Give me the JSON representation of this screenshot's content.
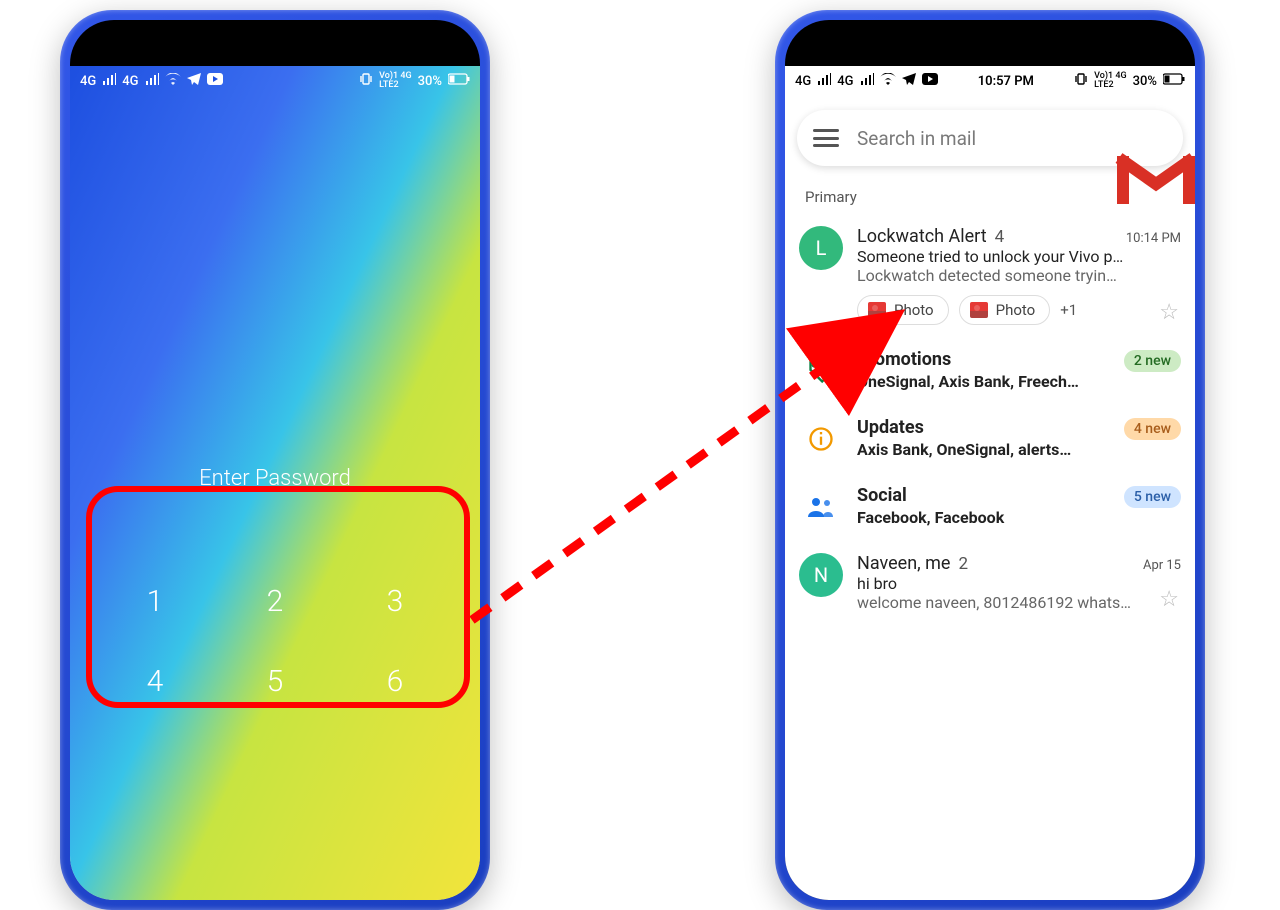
{
  "status": {
    "left1": "4G",
    "left2": "4G",
    "battery": "30%",
    "right_label": "Vo)1 4G\nLTE2",
    "time": "10:57 PM"
  },
  "lock": {
    "prompt": "Enter Password",
    "keys": [
      "1",
      "2",
      "3",
      "4",
      "5",
      "6"
    ]
  },
  "gmail": {
    "search_placeholder": "Search in mail",
    "primary_label": "Primary",
    "item1": {
      "sender": "Lockwatch Alert",
      "count": "4",
      "time": "10:14 PM",
      "subject": "Someone tried to unlock your Vivo p…",
      "preview": "Lockwatch detected someone tryin…",
      "chip": "Photo",
      "more": "+1",
      "avatar": "L"
    },
    "promotions": {
      "title": "Promotions",
      "sub": "OneSignal, Axis Bank, Freech…",
      "badge": "2 new"
    },
    "updates": {
      "title": "Updates",
      "sub": "Axis Bank, OneSignal, alerts…",
      "badge": "4 new"
    },
    "social": {
      "title": "Social",
      "sub": "Facebook, Facebook",
      "badge": "5 new"
    },
    "item2": {
      "sender": "Naveen, me",
      "count": "2",
      "time": "Apr 15",
      "subject": "hi bro",
      "preview": "welcome naveen, 8012486192 whats…",
      "avatar": "N"
    }
  }
}
